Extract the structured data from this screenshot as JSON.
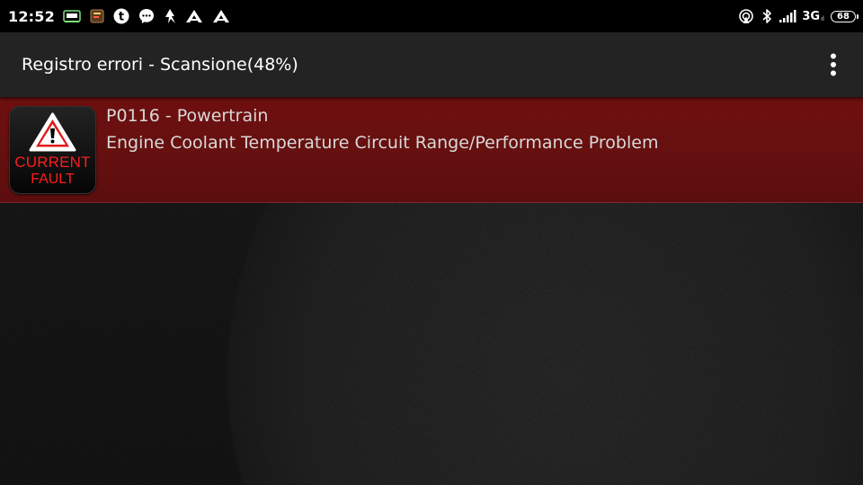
{
  "status_bar": {
    "time": "12:52",
    "notification_icons": [
      "obd-app-icon",
      "torque-app-icon",
      "t-app-icon",
      "messenger-icon",
      "mountain-icon",
      "drive-a-icon",
      "drive-a-icon"
    ],
    "network_type": "3G",
    "network_sub": "ıl",
    "battery_level": "68"
  },
  "app_bar": {
    "title": "Registro errori - Scansione(48%)"
  },
  "faults": [
    {
      "badge_line1": "CURRENT",
      "badge_line2": "FAULT",
      "code": "P0116 - Powertrain",
      "description": "Engine Coolant Temperature Circuit Range/Performance Problem"
    }
  ],
  "colors": {
    "fault_row": "#661010",
    "badge_text": "#ff1d1d",
    "app_bar": "#232323",
    "status_bar": "#000000"
  }
}
